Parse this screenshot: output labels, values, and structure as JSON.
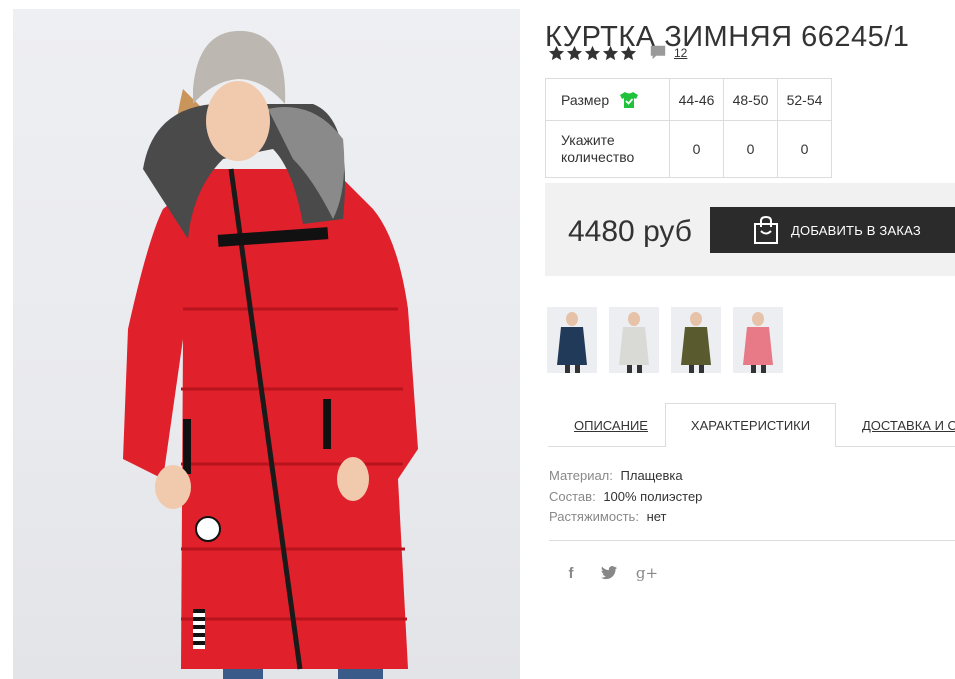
{
  "product": {
    "title": "КУРТКА ЗИМНЯЯ 66245/1",
    "rating_stars": 5,
    "review_count": "12"
  },
  "size_table": {
    "size_label": "Размер",
    "quantity_label": "Укажите количество",
    "sizes": [
      "44-46",
      "48-50",
      "52-54"
    ],
    "quantities": [
      "0",
      "0",
      "0"
    ]
  },
  "price": {
    "value": "4480 руб",
    "add_button": "ДОБАВИТЬ В ЗАКАЗ"
  },
  "thumbnails": [
    {
      "name": "navy",
      "color": "#223a5a"
    },
    {
      "name": "light-grey",
      "color": "#d9d9d6"
    },
    {
      "name": "olive",
      "color": "#5a5a2f"
    },
    {
      "name": "pink",
      "color": "#e77a86"
    }
  ],
  "tabs": {
    "description": "ОПИСАНИЕ",
    "characteristics": "ХАРАКТЕРИСТИКИ",
    "delivery": "ДОСТАВКА И ОПЛАТА",
    "active": "characteristics"
  },
  "specs": [
    {
      "key": "Материал:",
      "value": "Плащевка"
    },
    {
      "key": "Состав:",
      "value": "100% полиэстер"
    },
    {
      "key": "Растяжимость:",
      "value": "нет"
    }
  ],
  "social": {
    "facebook": "f",
    "twitter": "twitter-icon",
    "google_plus": "g+"
  },
  "colors": {
    "accent_green": "#1fc23a",
    "button_dark": "#2b2b2b",
    "jacket_red": "#e0202b"
  }
}
